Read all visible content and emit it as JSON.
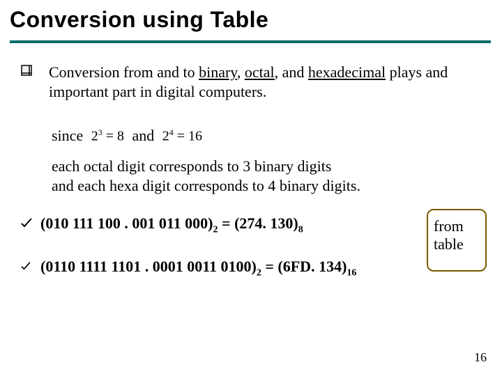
{
  "title": "Conversion using Table",
  "bullet": {
    "pre": "Conversion from and to ",
    "u1": "binary",
    "c1": ", ",
    "u2": "octal",
    "c2": ", and ",
    "u3": "hexadecimal",
    "post": " plays and important part in digital computers."
  },
  "since": {
    "word_since": "since",
    "math1_base": "2",
    "math1_exp": "3",
    "math1_eq": " = 8",
    "word_and": "and",
    "math2_base": "2",
    "math2_exp": "4",
    "math2_eq": " = 16"
  },
  "correspond": {
    "line1": "each octal digit corresponds to 3 binary digits",
    "line2": "and each hexa digit corresponds to 4 binary digits."
  },
  "ex1": {
    "lhs": "(010  111 100 . 001 011 000)",
    "lhs_sub": "2",
    "eq": " = ",
    "rhs": "(274. 130)",
    "rhs_sub": "8"
  },
  "ex2": {
    "lhs": "(0110  1111 1101 . 0001 0011 0100)",
    "lhs_sub": "2",
    "eq": " = ",
    "rhs": "(6FD. 134)",
    "rhs_sub": "16"
  },
  "note": {
    "line1": "from",
    "line2": "table"
  },
  "page": "16",
  "colors": {
    "rule": "#0b6b6b",
    "box_border": "#7a5a00"
  }
}
